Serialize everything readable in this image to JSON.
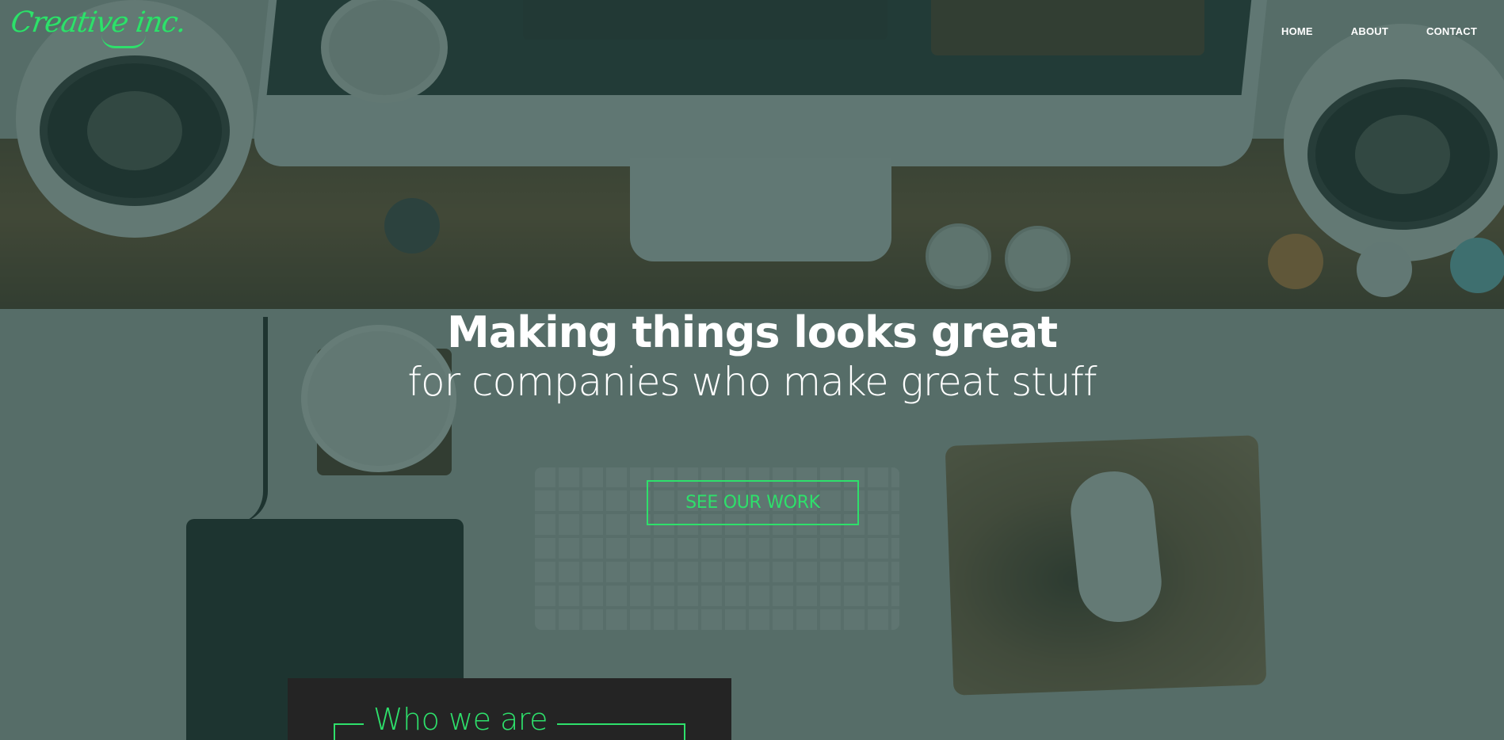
{
  "brand": {
    "logo_text": "Creative inc.",
    "accent_color": "#2ee06b"
  },
  "nav": {
    "items": [
      {
        "label": "HOME"
      },
      {
        "label": "ABOUT"
      },
      {
        "label": "CONTACT"
      }
    ]
  },
  "hero": {
    "title": "Making things looks great",
    "subtitle": "for companies who make great stuff",
    "cta_label": "SEE OUR WORK"
  },
  "about": {
    "heading": "Who we are"
  }
}
